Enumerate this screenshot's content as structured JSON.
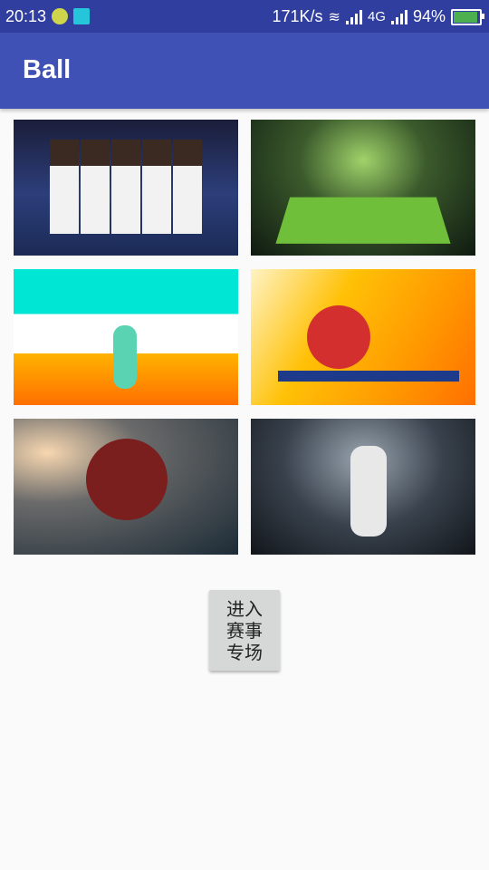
{
  "status_bar": {
    "time": "20:13",
    "net_speed": "171K/s",
    "network": "4G",
    "battery": "94%",
    "battery_level": 0.94
  },
  "app_bar": {
    "title": "Ball"
  },
  "gallery": {
    "images": [
      {
        "name": "basketball-image"
      },
      {
        "name": "soccer-stadium-image"
      },
      {
        "name": "badminton-image"
      },
      {
        "name": "table-tennis-image"
      },
      {
        "name": "american-football-image"
      },
      {
        "name": "baseball-image"
      }
    ]
  },
  "enter_button": {
    "label": "进入\n赛事\n专场"
  },
  "colors": {
    "status_bar_bg": "#303f9f",
    "app_bar_bg": "#3f51b5",
    "page_bg": "#fafafa",
    "button_bg": "#d6d7d7"
  }
}
